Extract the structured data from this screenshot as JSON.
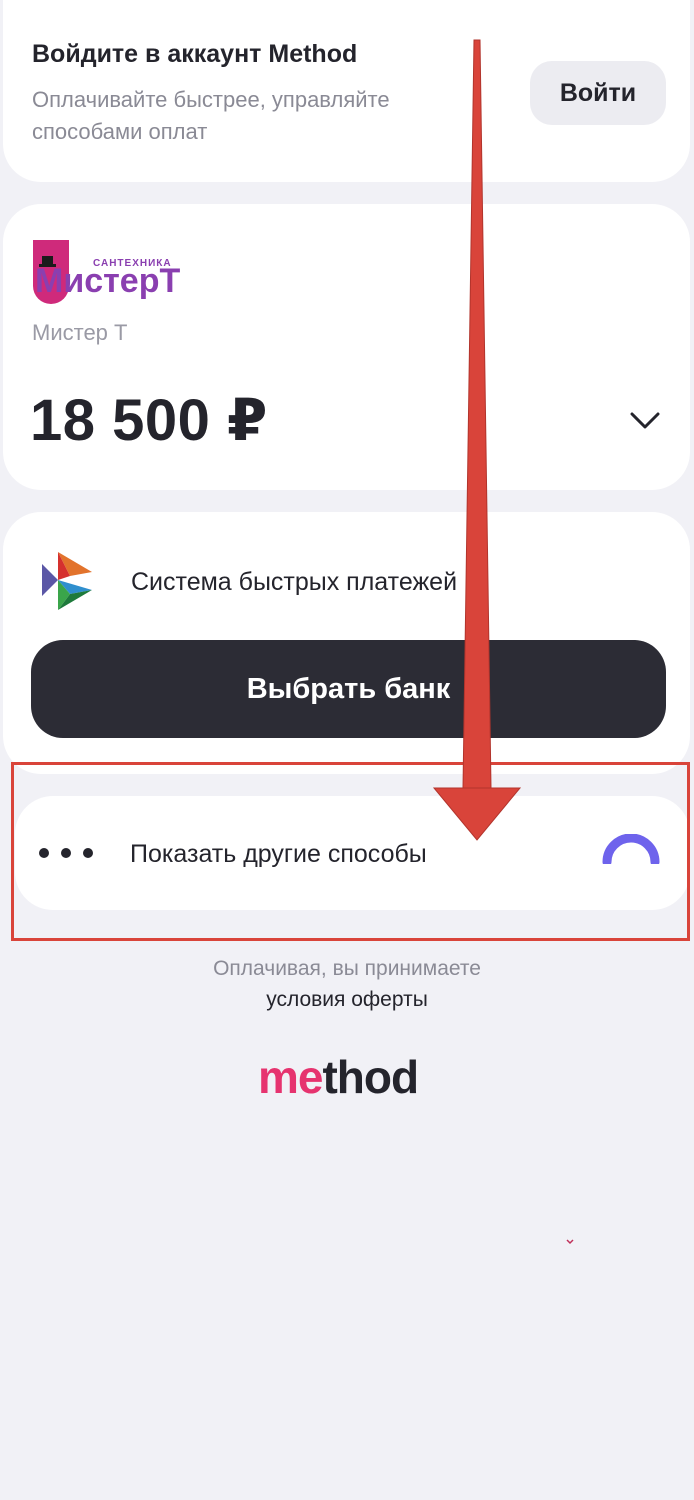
{
  "login": {
    "title": "Войдите в аккаунт Method",
    "subtitle": "Оплачивайте быстрее, управляйте способами оплат",
    "button_label": "Войти"
  },
  "merchant": {
    "logo_small": "САНТЕХНИКА",
    "logo_big": "МистерТ",
    "name": "Мистер Т",
    "amount": "18 500 ₽",
    "expand_icon": "chevron-down-icon"
  },
  "payment": {
    "sbp_icon": "sbp-logo-icon",
    "sbp_label": "Система быстрых платежей",
    "select_bank_label": "Выбрать банк"
  },
  "other_methods": {
    "icon": "more-dots-icon",
    "label": "Показать другие способы",
    "loading_icon": "loading-spinner-icon"
  },
  "footer": {
    "line1": "Оплачивая, вы принимаете",
    "offer_link": "условия оферты",
    "brand_part1": "me",
    "brand_part2": "thod"
  },
  "colors": {
    "accent_red": "#d9443a",
    "brand_pink": "#e6336f",
    "spinner": "#6e63ec",
    "button_dark": "#2c2c35"
  }
}
